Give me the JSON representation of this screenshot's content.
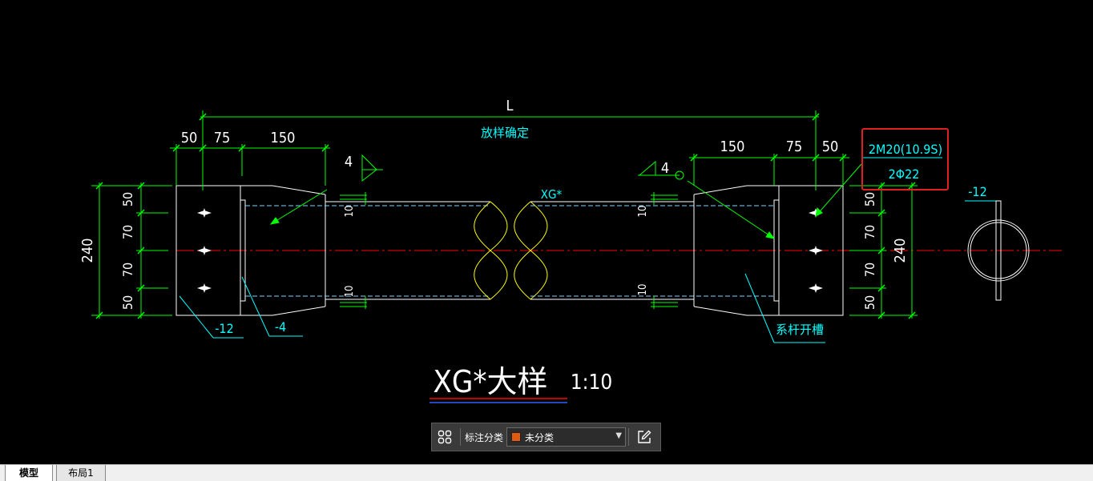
{
  "drawing": {
    "title": "XG*大样",
    "scale": "1:10",
    "overall_length": "L",
    "length_note": "放样确定",
    "member_tag": "XG*",
    "bolt_spec": "2M20(10.9S)",
    "hole_spec": "2Φ22",
    "slot_note": "系杆开槽",
    "plate_thk_left": "-12",
    "plate_thk_right": "-12",
    "stiffener_thk": "-4",
    "weld_size_left": "4",
    "weld_size_right": "4",
    "dims_top_left": [
      "50",
      "75",
      "150"
    ],
    "dims_top_right": [
      "150",
      "75",
      "50"
    ],
    "dims_side": [
      "50",
      "70",
      "70",
      "50"
    ],
    "height_total": "240",
    "weld_len": "10",
    "colors": {
      "outline": "#ffffff",
      "dimension": "#00ff00",
      "text": "#00ffff",
      "centerline": "#ff0000",
      "breakline": "#ffff00",
      "hidden": "#7fd4ff",
      "highlight_box": "#e02020"
    }
  },
  "toolbar": {
    "category_label": "标注分类",
    "selected_option": "未分类",
    "swatch_color": "#e05a10",
    "grid_icon": "grid-icon",
    "edit_icon": "edit-icon"
  },
  "tabs": [
    {
      "label": "模型"
    },
    {
      "label": "布局1"
    }
  ]
}
